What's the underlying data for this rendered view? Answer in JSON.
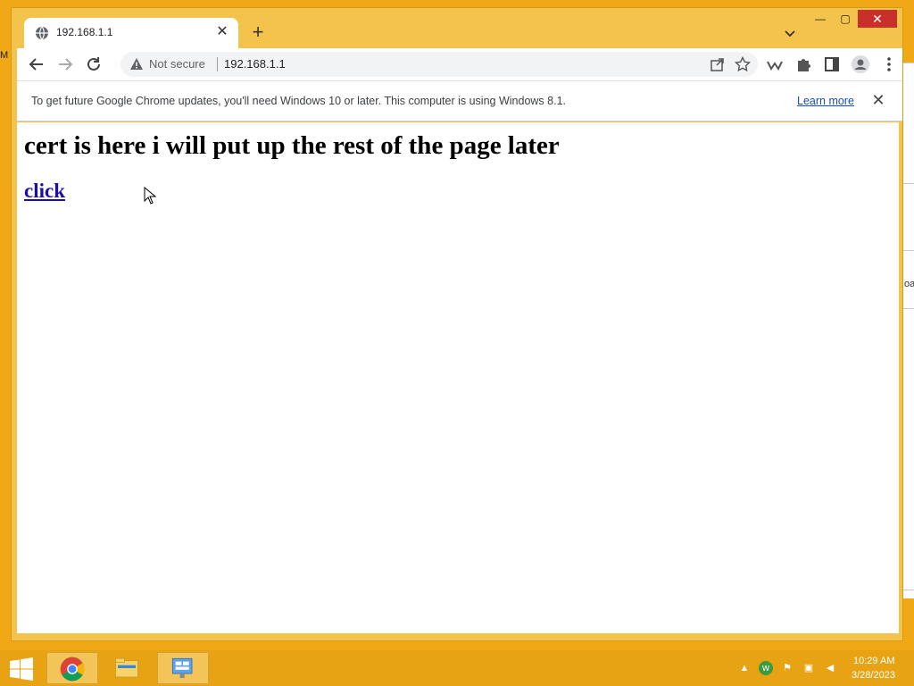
{
  "desktop": {
    "left_edge_text": "M",
    "right_window_text": "oa"
  },
  "browser": {
    "tab": {
      "title": "192.168.1.1",
      "close_glyph": "✕"
    },
    "new_tab_glyph": "+",
    "window_controls": {
      "minimize": "—",
      "maximize": "▢",
      "close": "✕"
    },
    "toolbar": {
      "security_label": "Not secure",
      "url": "192.168.1.1"
    },
    "infobar": {
      "message": "To get future Google Chrome updates, you'll need Windows 10 or later. This computer is using Windows 8.1.",
      "link_label": "Learn more",
      "close_glyph": "✕"
    },
    "page": {
      "heading": "cert is here i will put up the rest of the page later",
      "link": "click"
    }
  },
  "taskbar": {
    "clock": {
      "time": "10:29 AM",
      "date": "3/28/2023"
    },
    "accent_color": "#e8a314"
  },
  "icons": [
    "globe-icon",
    "back-icon",
    "forward-icon",
    "reload-icon",
    "warning-icon",
    "share-icon",
    "star-icon",
    "extension-icon",
    "puzzle-icon",
    "sidepanel-icon",
    "profile-icon",
    "menu-icon",
    "windows-start-icon",
    "chrome-icon",
    "file-explorer-icon",
    "control-panel-icon"
  ]
}
